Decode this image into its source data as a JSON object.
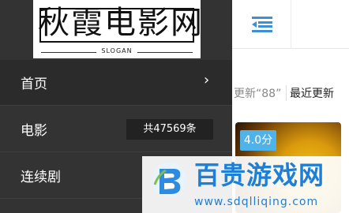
{
  "logo": {
    "title": "秋霞电影网",
    "slogan": "SLOGAN"
  },
  "header": {
    "menu_icon": "menu-collapse-icon",
    "accent_color": "#3d8fd6"
  },
  "drawer": {
    "items": [
      {
        "label": "首页",
        "arrow": "›",
        "active": true
      },
      {
        "label": "电影",
        "count": "共47569条"
      },
      {
        "label": "连续剧"
      }
    ]
  },
  "search": {
    "tail_text": "更新“88”",
    "latest_label": "最近更新"
  },
  "card": {
    "score": "4.0分",
    "badge_color": "#4fb3ea"
  },
  "watermark": {
    "title": "百贵游戏网",
    "url": "www.sdqlliqing.com",
    "color": "#1e7fd6"
  }
}
